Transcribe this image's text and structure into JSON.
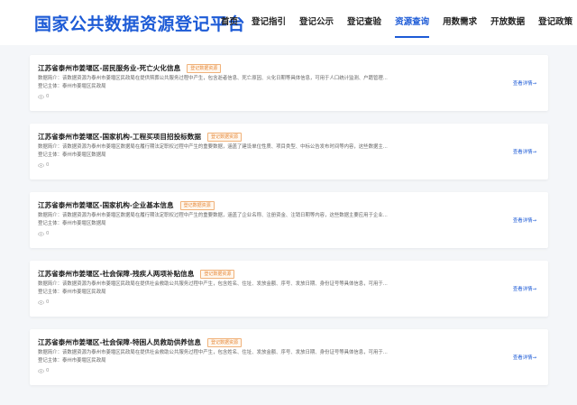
{
  "header": {
    "logo": "国家公共数据资源登记平台",
    "nav": [
      {
        "label": "首页"
      },
      {
        "label": "登记指引"
      },
      {
        "label": "登记公示"
      },
      {
        "label": "登记查验"
      },
      {
        "label": "资源查询",
        "active": true
      },
      {
        "label": "用数需求"
      },
      {
        "label": "开放数据"
      },
      {
        "label": "登记政策"
      }
    ]
  },
  "colors": {
    "accent": "#1d5bd6",
    "tag": "#e6893a",
    "background": "#f4f6f9"
  },
  "cards": [
    {
      "title": "江苏省泰州市姜堰区-居民服务业-死亡火化信息",
      "tag": "登记数据资源",
      "desc": "数据简介：该数据资源为泰州市姜堰区民政局在提供殡葬公共服务过程中产生，包含逝者信息、死亡原因、火化日期等具体信息，可用于人口统计监测、户籍管理...",
      "owner": "登记主体：泰州市姜堰区民政局",
      "views": "0",
      "detail": "查看详情→"
    },
    {
      "title": "江苏省泰州市姜堰区-国家机构-工程买项目招投标数据",
      "tag": "登记数据资源",
      "desc": "数据简介：该数据资源为泰州市姜堰区数据局在履行期法定职权过程中产生的重要数据，涵盖了建设单位性质、项目类型、中标公告发布时间等内容，这些数据主...",
      "owner": "登记主体：泰州市姜堰区数据局",
      "views": "0",
      "detail": "查看详情→"
    },
    {
      "title": "江苏省泰州市姜堰区-国家机构-企业基本信息",
      "tag": "登记数据资源",
      "desc": "数据简介：该数据资源为泰州市姜堰区数据局在履行期法定职权过程中产生的重要数据，涵盖了企业名称、注册资金、注销日期等内容，这些数据主要应用于企业...",
      "owner": "登记主体：泰州市姜堰区数据局",
      "views": "0",
      "detail": "查看详情→"
    },
    {
      "title": "江苏省泰州市姜堰区-社会保障-残疾人两项补贴信息",
      "tag": "登记数据资源",
      "desc": "数据简介：该数据资源为泰州市姜堰区民政局在提供社会救助公共服务过程中产生，包含姓名、住址、发放金额、序号、发放日期、身份证号等具体信息，可用于...",
      "owner": "登记主体：泰州市姜堰区民政局",
      "views": "0",
      "detail": "查看详情→"
    },
    {
      "title": "江苏省泰州市姜堰区-社会保障-特困人员救助供养信息",
      "tag": "登记数据资源",
      "desc": "数据简介：该数据资源为泰州市姜堰区民政局在提供社会救助公共服务过程中产生，包含姓名、住址、发放金额、序号、发放日期、身份证号等具体信息，可用于...",
      "owner": "登记主体：泰州市姜堰区民政局",
      "views": "0",
      "detail": "查看详情→"
    }
  ]
}
